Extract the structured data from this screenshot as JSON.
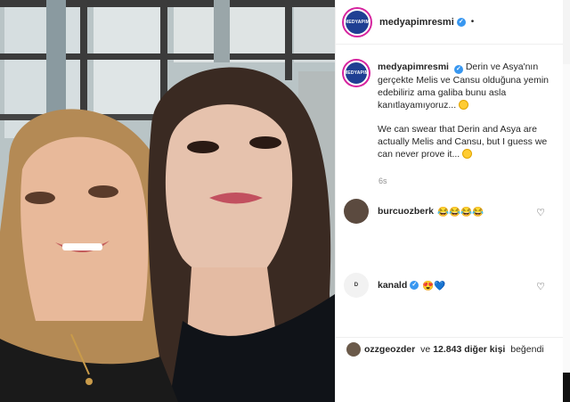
{
  "post": {
    "username": "medyapimresmi",
    "avatar_text": "MEDYAPIM",
    "more_dot": "•",
    "caption_tr": "Derin ve Asya'nın gerçekte Melis ve Cansu olduğuna yemin edebiliriz ama galiba bunu asla kanıtlayamıyoruz...",
    "caption_en": "We can swear that Derin and Asya are actually Melis and Cansu, but I guess we can never prove it...",
    "time": "6s"
  },
  "comments": [
    {
      "user": "burcuozberk",
      "content": "😂😂😂😂"
    },
    {
      "user": "kanald",
      "content": "😍💙"
    }
  ],
  "likes": {
    "user": "ozzgeozder",
    "text_mid": "ve",
    "count": "12.843 diğer kişi",
    "suffix": "beğendi"
  },
  "colors": {
    "verified": "#3897f0",
    "brand": "#1f3f93",
    "text": "#262626",
    "muted": "#8e8e8e"
  }
}
